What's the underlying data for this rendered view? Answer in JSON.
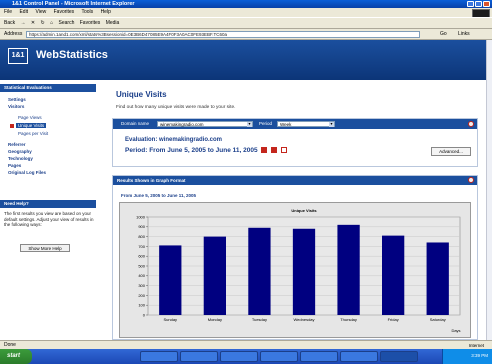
{
  "window": {
    "title": "1&1 Control Panel - Microsoft Internet Explorer"
  },
  "menubar": [
    "File",
    "Edit",
    "View",
    "Favorites",
    "Tools",
    "Help"
  ],
  "toolbar": {
    "back": "Back",
    "search": "Search",
    "favorites": "Favorites",
    "media": "Media"
  },
  "addressbar": {
    "label": "Address",
    "url": "https://admin.1and1.com/xml/stats%3Bsessionid=0E3B6D47085E9A4F0F3A0AC0FE93EBF.TC60a",
    "go": "Go",
    "links": "Links"
  },
  "site": {
    "logo": "1&1",
    "title": "WebStatistics"
  },
  "sidebar": {
    "section_title": "Statistical Evaluations",
    "items": [
      {
        "label": "Settings",
        "level": 1
      },
      {
        "label": "Visitors",
        "level": 1
      },
      {
        "label": "Page Views",
        "level": 2
      },
      {
        "label": "Unique Visits",
        "level": 2,
        "active": true
      },
      {
        "label": "Pages per Visit",
        "level": 2
      },
      {
        "label": "Referrer",
        "level": 1
      },
      {
        "label": "Geography",
        "level": 1
      },
      {
        "label": "Technology",
        "level": 1
      },
      {
        "label": "Pages",
        "level": 1
      },
      {
        "label": "Original Log Files",
        "level": 1
      }
    ],
    "help_title": "Need Help?",
    "help_text": "The first results you view are based on your default settings. Adjust your view of results in the following ways:",
    "help_button": "Show More Help"
  },
  "main": {
    "title": "Unique Visits",
    "description": "Find out how many unique visits were made to your site.",
    "domain_label": "Domain name",
    "domain_value": "winemakingradio.com",
    "period_label": "Period",
    "period_value": "Week",
    "evaluation": "Evaluation: winemakingradio.com",
    "period_text": "Period:     From June 5, 2005 to June 11, 2005",
    "advanced_button": "Advanced..."
  },
  "graph": {
    "header": "Results Shown in Graph Format",
    "range": "From June 5, 2005 to June 11, 2005"
  },
  "chart_data": {
    "type": "bar",
    "title": "Unique Visits",
    "xlabel": "Days",
    "ylabel": "",
    "categories": [
      "Sunday",
      "Monday",
      "Tuesday",
      "Wednesday",
      "Thursday",
      "Friday",
      "Saturday"
    ],
    "values": [
      710,
      800,
      890,
      880,
      920,
      810,
      740
    ],
    "ylim": [
      0,
      1000
    ],
    "yticks": [
      0,
      100,
      200,
      300,
      400,
      500,
      600,
      700,
      800,
      900,
      1000
    ],
    "grid": true,
    "bar_color": "#000080"
  },
  "statusbar": {
    "left": "Done",
    "zone": "Internet"
  },
  "taskbar": {
    "start": "start",
    "clock": "3:39 PM"
  }
}
